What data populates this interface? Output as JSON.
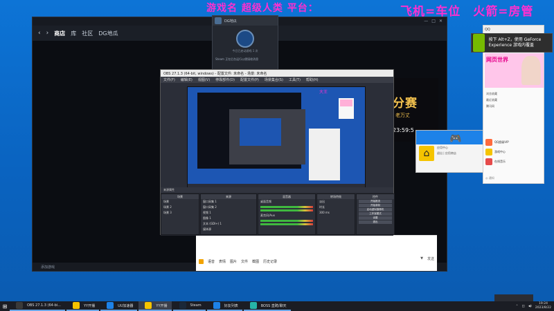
{
  "overlay": {
    "title": "游戏名 超级人类",
    "platform": "平台：",
    "right_text": "飞机=车位　火箭=房管"
  },
  "steam": {
    "top_text": "",
    "nav": [
      "商店",
      "库",
      "社区",
      "DG地瓜"
    ],
    "status": "添加游戏",
    "friends_badge": "",
    "controls": [
      "—",
      "□",
      "✕"
    ]
  },
  "steam_popup": {
    "name": "DG地瓜",
    "caption": "今日已启动游戏 1 次",
    "text": "Steam 正在后台运行以便接收消息"
  },
  "obs": {
    "title": "OBS 27.1.3 (64-bit, windows) - 配置文件: 未命名 - 场景: 未命名",
    "menu": [
      "文件(F)",
      "编辑(E)",
      "视图(V)",
      "停靠部件(D)",
      "配置文件(P)",
      "场景集合(S)",
      "工具(T)",
      "帮助(H)"
    ],
    "preview_text": "大王",
    "dock_title": "来源属性",
    "columns": {
      "scenes": {
        "title": "场景",
        "items": [
          "场景",
          "场景 2",
          "场景 3"
        ]
      },
      "sources": {
        "title": "来源",
        "items": [
          "窗口采集 1",
          "窗口采集 2",
          "视频 1",
          "图像 1",
          "文本 (GDI+) 1",
          "媒体源"
        ]
      },
      "mixer": {
        "title": "混音器",
        "items": [
          "桌面音频",
          "麦克风/Aux"
        ]
      },
      "transitions": {
        "title": "转场特效",
        "items": [
          "淡出",
          "时长",
          "300 ms"
        ]
      },
      "controls": {
        "title": "控件",
        "items": [
          "开始推流",
          "开始录制",
          "启动虚拟摄像机",
          "工作室模式",
          "设置",
          "退出"
        ]
      }
    }
  },
  "banner": {
    "big": "分赛",
    "sub": "老万丈",
    "time": "23:59:5"
  },
  "chat": {
    "placeholder": "",
    "toolbar": [
      "语音",
      "表情",
      "图片",
      "文件",
      "截图",
      "历史记录"
    ],
    "right": [
      "▼",
      "发送"
    ]
  },
  "gamepad_popup": {
    "line1": "应用中心",
    "line2": "退出 | 应用商店"
  },
  "nvidia": {
    "text": "按下 Alt+Z，使用 GeForce Experience 游戏内覆盖"
  },
  "qq": {
    "header": "QQ",
    "promo": "网页世界",
    "list": [
      "浏览收藏",
      "最近收藏",
      "腾讯网"
    ],
    "apps": [
      {
        "name": "QQ超级VIP",
        "color": "#ff6b3d"
      },
      {
        "name": "游戏中心",
        "color": "#f5c400"
      },
      {
        "name": "在线音乐",
        "color": "#e64b4b"
      }
    ],
    "footer": "◎ 通知"
  },
  "taskbar": {
    "tasks": [
      {
        "label": "OBS 27.1.3 (64-bi...",
        "active": false,
        "color": "#3a3a3a"
      },
      {
        "label": "YY开播",
        "active": false,
        "color": "#f5c400"
      },
      {
        "label": "UU加速器",
        "active": false,
        "color": "#1d82e8"
      },
      {
        "label": "YY开播",
        "active": true,
        "color": "#f5c400"
      },
      {
        "label": "Steam",
        "active": false,
        "color": "#1b2838"
      },
      {
        "label": "好友列表",
        "active": false,
        "color": "#1d82e8"
      },
      {
        "label": "BOSS 直聘/聊天",
        "active": false,
        "color": "#26b4a8"
      }
    ],
    "time": "19:24",
    "date": "2023/8/22",
    "tray_popup": ""
  }
}
